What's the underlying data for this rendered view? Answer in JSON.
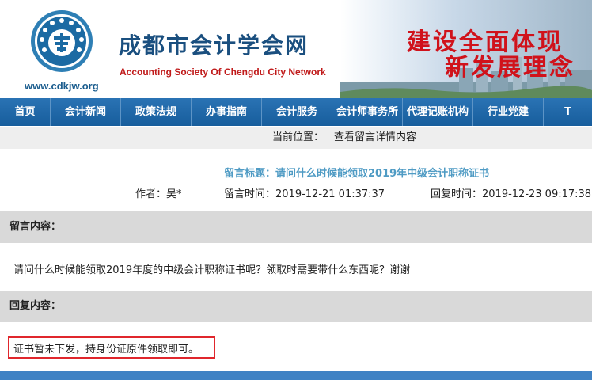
{
  "header": {
    "site_name_cn": "成都市会计学会网",
    "site_name_en": "Accounting Society Of Chengdu City Network",
    "domain": "www.cdkjw.org",
    "slogan_line1": "建设全面体现",
    "slogan_line2": "新发展理念",
    "accent_color": "#1a4f7f",
    "slogan_color": "#d0121b"
  },
  "nav": {
    "items": [
      {
        "label": "首页"
      },
      {
        "label": "会计新闻"
      },
      {
        "label": "政策法规"
      },
      {
        "label": "办事指南"
      },
      {
        "label": "会计服务"
      },
      {
        "label": "会计师事务所"
      },
      {
        "label": "代理记账机构"
      },
      {
        "label": "行业党建"
      }
    ],
    "bg_color": "#1f67a8"
  },
  "breadcrumb": {
    "label": "当前位置：",
    "value": "查看留言详情内容"
  },
  "message": {
    "title": "留言标题：请问什么时候能领取2019年中级会计职称证书",
    "author": "作者：吴*",
    "post_time": "留言时间：2019-12-21 01:37:37",
    "reply_time": "回复时间：2019-12-23 09:17:38"
  },
  "content": {
    "heading": "留言内容：",
    "text": "请问什么时候能领取2019年度的中级会计职称证书呢？领取时需要带什么东西呢？谢谢"
  },
  "reply": {
    "heading": "回复内容：",
    "text": "证书暂未下发，持身份证原件领取即可。",
    "highlight_color": "#e0262c"
  }
}
